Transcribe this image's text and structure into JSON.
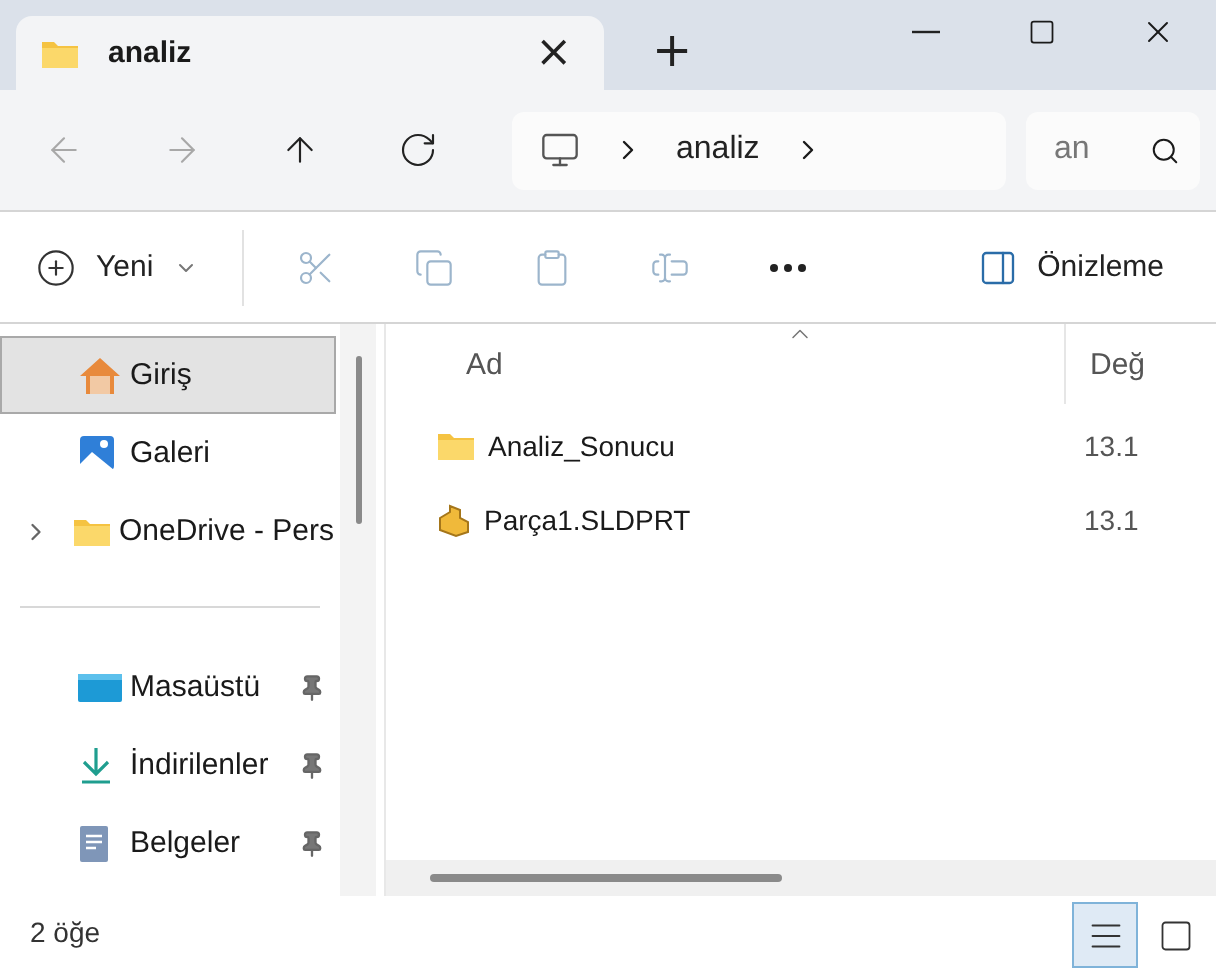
{
  "tab": {
    "title": "analiz",
    "close": "×",
    "new_tab": "+"
  },
  "nav": [
    {
      "kind": "back",
      "disabled": true
    },
    {
      "kind": "forward",
      "disabled": true
    },
    {
      "kind": "up",
      "disabled": false
    },
    {
      "kind": "refresh",
      "disabled": false
    }
  ],
  "address": {
    "crumbs": [
      "analiz"
    ]
  },
  "search": {
    "placeholder": "an"
  },
  "toolbar": {
    "new_label": "Yeni",
    "actions": [
      {
        "kind": "cut",
        "disabled": true
      },
      {
        "kind": "copy",
        "disabled": true
      },
      {
        "kind": "paste",
        "disabled": true
      },
      {
        "kind": "rename",
        "disabled": true
      },
      {
        "kind": "more",
        "disabled": false
      }
    ],
    "preview_label": "Önizleme"
  },
  "sidebar": {
    "top": [
      {
        "label": "Giriş",
        "kind": "home",
        "selected": true,
        "expandable": false
      },
      {
        "label": "Galeri",
        "kind": "gallery",
        "selected": false,
        "expandable": false
      },
      {
        "label": "OneDrive - Pers",
        "kind": "folder",
        "selected": false,
        "expandable": true
      }
    ],
    "pinned": [
      {
        "label": "Masaüstü",
        "kind": "desktop",
        "selected": false,
        "pinned": true
      },
      {
        "label": "İndirilenler",
        "kind": "download",
        "selected": false,
        "pinned": true
      },
      {
        "label": "Belgeler",
        "kind": "documents",
        "selected": false,
        "pinned": true
      }
    ]
  },
  "table": {
    "columns": [
      "Ad",
      "Değ"
    ],
    "rows": [
      {
        "kind": "folder",
        "name": "Analiz_Sonucu",
        "column_2": "13.1",
        "selected": false
      },
      {
        "kind": "part",
        "name": "Parça1.SLDPRT",
        "column_2": "13.1",
        "selected": false
      }
    ]
  },
  "status_bar": {
    "count": "2 öğe",
    "views": [
      {
        "kind": "details",
        "selected": true
      },
      {
        "kind": "tiles",
        "selected": false
      }
    ]
  }
}
